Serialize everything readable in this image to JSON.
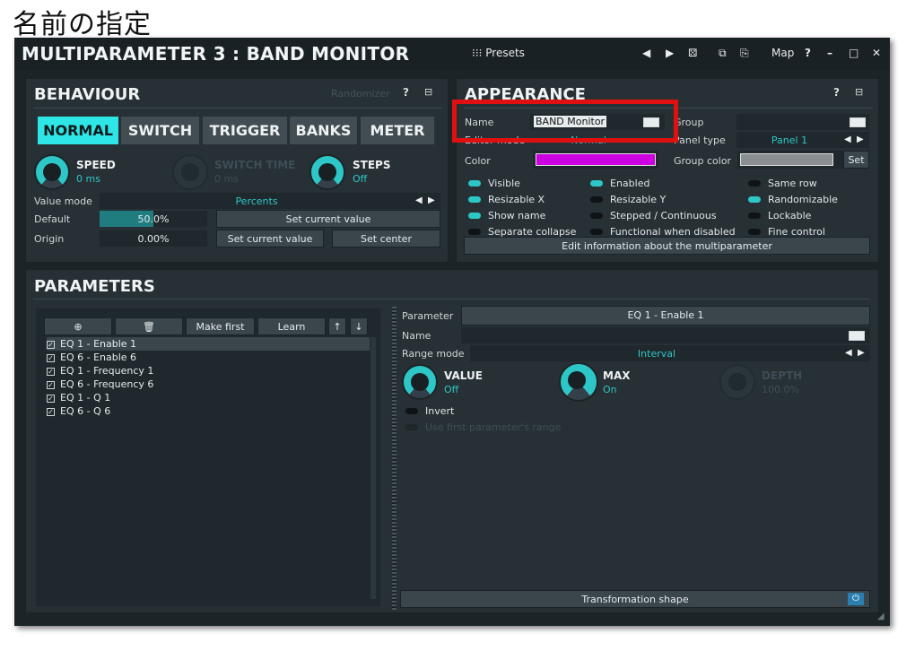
{
  "caption": "名前の指定",
  "window": {
    "title": "MULTIPARAMETER 3 : BAND MONITOR",
    "presets": "Presets",
    "map": "Map",
    "help": "?",
    "minimize": "–",
    "maximize": "□",
    "close": "✕"
  },
  "behaviour": {
    "heading": "BEHAVIOUR",
    "randomizer": "Randomizer",
    "tabs": [
      "NORMAL",
      "SWITCH",
      "TRIGGER",
      "BANKS",
      "METER"
    ],
    "knobs": [
      {
        "label": "SPEED",
        "value": "0 ms"
      },
      {
        "label": "SWITCH TIME",
        "value": "0 ms"
      },
      {
        "label": "STEPS",
        "value": "Off"
      }
    ],
    "value_mode_label": "Value mode",
    "value_mode": "Percents",
    "default_label": "Default",
    "default_value": "50.0%",
    "default_fill": 0.5,
    "origin_label": "Origin",
    "origin_value": "0.00%",
    "set_current_value": "Set current value",
    "set_center": "Set center"
  },
  "appearance": {
    "heading": "APPEARANCE",
    "name_label": "Name",
    "name_value": "BAND Monitor",
    "editor_mode_label": "Editor mode",
    "editor_mode": "Normal",
    "group_label": "Group",
    "panel_type_label": "Panel type",
    "panel_type": "Panel 1",
    "color_label": "Color",
    "color": "#cc00e0",
    "group_color_label": "Group color",
    "group_color": "#8a8e90",
    "set_label": "Set",
    "toggles": [
      {
        "label": "Visible",
        "on": true
      },
      {
        "label": "Enabled",
        "on": true
      },
      {
        "label": "Same row",
        "on": false
      },
      {
        "label": "Resizable X",
        "on": true
      },
      {
        "label": "Resizable Y",
        "on": false
      },
      {
        "label": "Randomizable",
        "on": true
      },
      {
        "label": "Show name",
        "on": true
      },
      {
        "label": "Stepped / Continuous",
        "on": false
      },
      {
        "label": "Lockable",
        "on": false
      },
      {
        "label": "Separate collapse",
        "on": false
      },
      {
        "label": "Functional when disabled",
        "on": false
      },
      {
        "label": "Fine control",
        "on": false
      }
    ],
    "edit_info": "Edit information about the multiparameter"
  },
  "parameters": {
    "heading": "PARAMETERS",
    "make_first": "Make first",
    "learn": "Learn",
    "list": [
      "EQ 1 - Enable 1",
      "EQ 6 - Enable 6",
      "EQ 1 - Frequency 1",
      "EQ 6 - Frequency 6",
      "EQ 1 - Q 1",
      "EQ 6 - Q 6"
    ],
    "parameter_label": "Parameter",
    "parameter_value": "EQ 1 - Enable 1",
    "name_label": "Name",
    "range_mode_label": "Range mode",
    "range_mode": "Interval",
    "knobs": [
      {
        "label": "VALUE",
        "value": "Off"
      },
      {
        "label": "MAX",
        "value": "On"
      },
      {
        "label": "DEPTH",
        "value": "100.0%"
      }
    ],
    "invert": "Invert",
    "use_first_range": "Use first parameter's range",
    "transformation_shape": "Transformation shape"
  },
  "colors": {
    "accent": "#2ee6e6",
    "highlight": "#e01010",
    "background": "#1c2428"
  }
}
